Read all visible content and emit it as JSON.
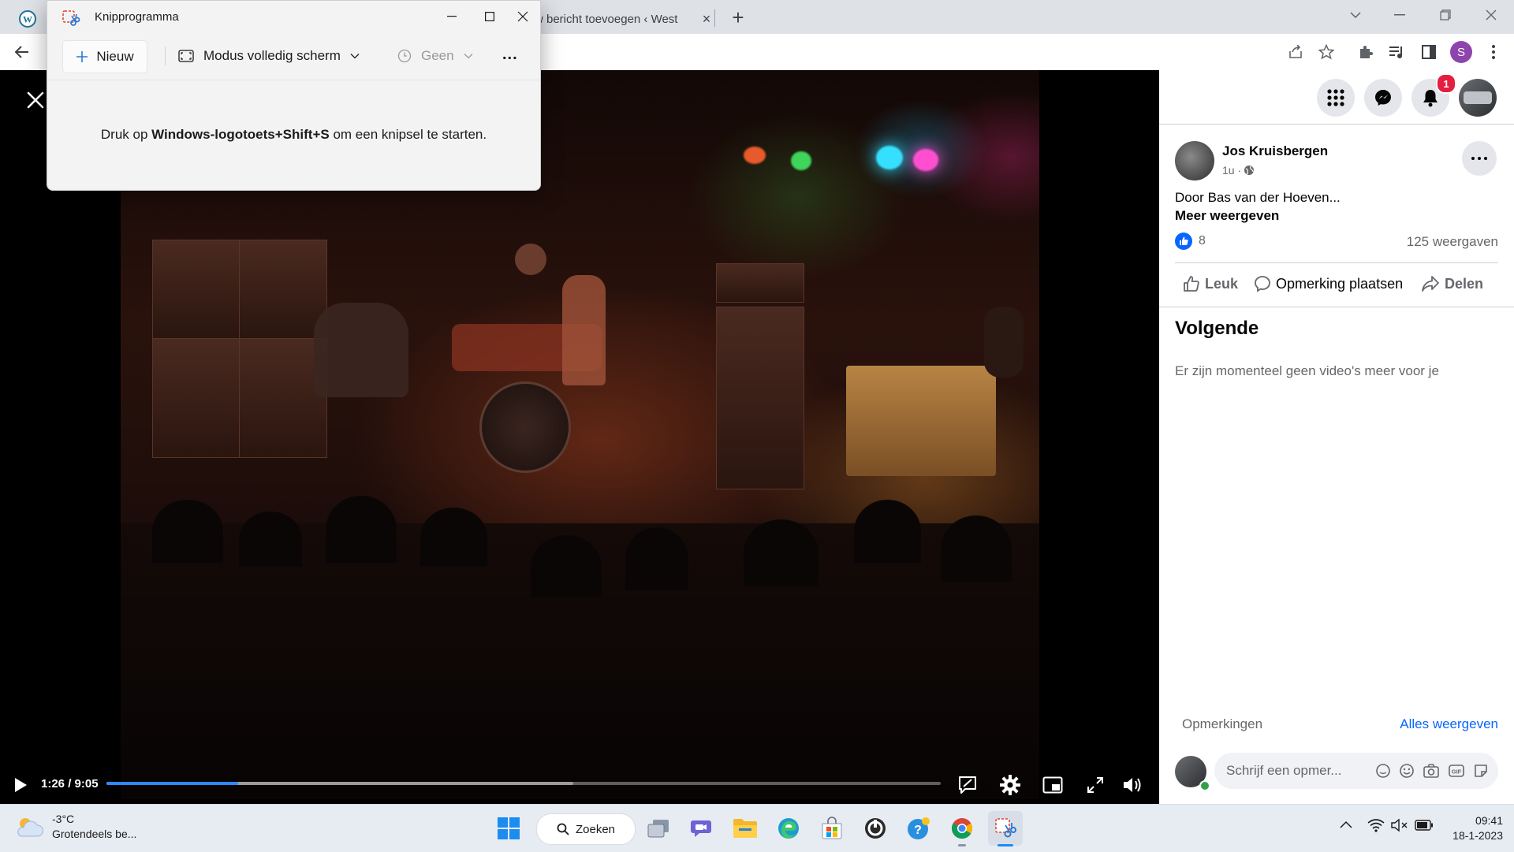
{
  "browser": {
    "tab_title": "w bericht toevoegen ‹ West",
    "tab_close": "×",
    "new_tab": "+",
    "profile_initial": "S"
  },
  "video": {
    "time": "1:26 / 9:05",
    "progress": 0.158,
    "buffered": 0.56
  },
  "post": {
    "author": "Jos Kruisbergen",
    "age": "1u ·",
    "text": "Door Bas van der Hoeven...",
    "more": "Meer weergeven",
    "likes": "8",
    "views": "125 weergaven",
    "actions": {
      "like": "Leuk",
      "comment": "Opmerking plaatsen",
      "share": "Delen"
    }
  },
  "up_next": {
    "title": "Volgende",
    "empty": "Er zijn momenteel geen video's meer voor je"
  },
  "comments": {
    "label": "Opmerkingen",
    "see_all": "Alles weergeven",
    "placeholder": "Schrijf een opmer..."
  },
  "header": {
    "notification_count": "1"
  },
  "snipping_tool": {
    "title": "Knipprogramma",
    "new_label": "Nieuw",
    "mode_label": "Modus volledig scherm",
    "delay_label": "Geen",
    "more_label": "...",
    "hint_pre": "Druk op ",
    "hint_keys": "Windows-logotoets+Shift+S",
    "hint_post": " om een knipsel te starten."
  },
  "taskbar": {
    "weather_temp": "-3°C",
    "weather_desc": "Grotendeels be...",
    "search_label": "Zoeken",
    "clock_time": "09:41",
    "clock_date": "18-1-2023"
  },
  "colors": {
    "fb_blue": "#0866ff",
    "progress": "#2d88ff",
    "badge": "#e41e3f"
  }
}
